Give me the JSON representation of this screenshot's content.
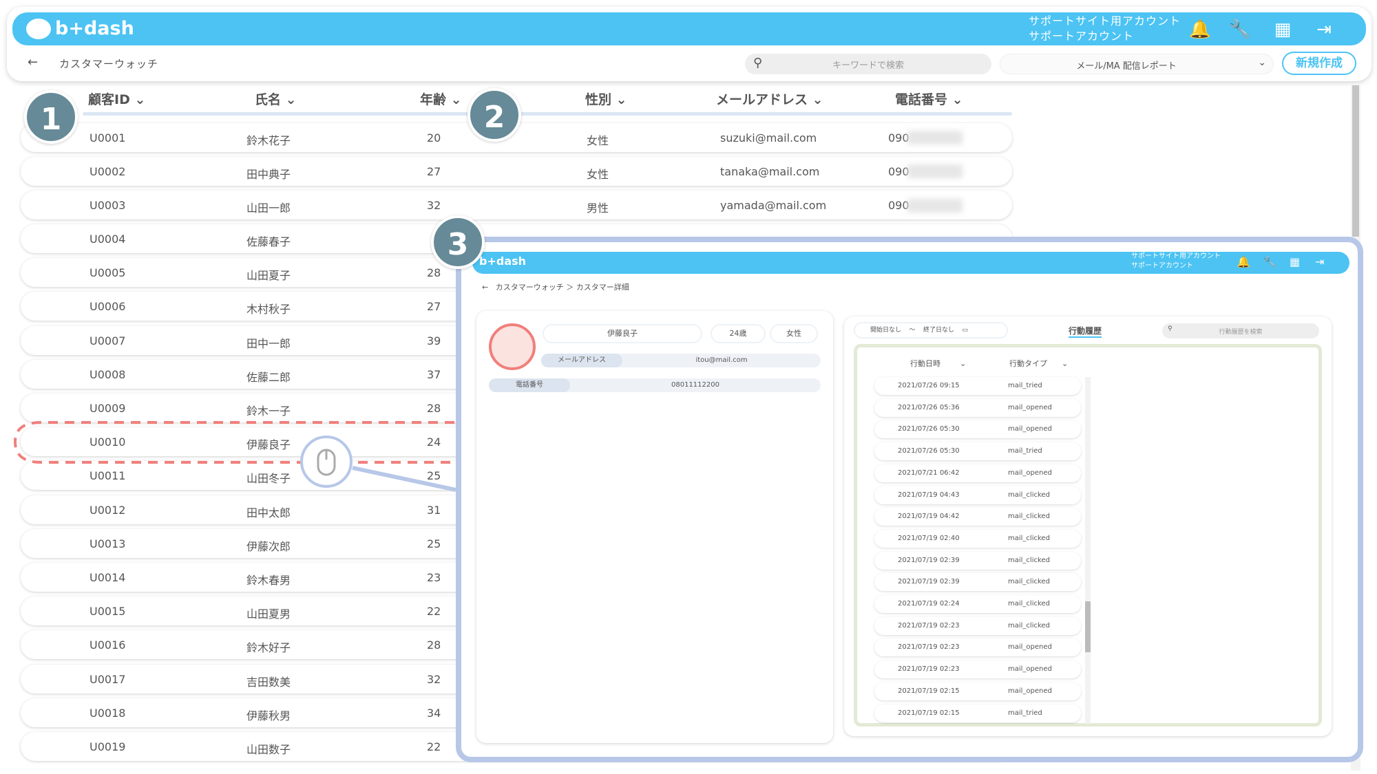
{
  "header": {
    "logo": "b+dash",
    "account_line1": "サポートサイト用アカウント",
    "account_line2": "サポートアカウント"
  },
  "nav": {
    "back": "←",
    "breadcrumb": "カスタマーウォッチ",
    "search_placeholder": "キーワードで検索",
    "report_select": "メール/MA 配信レポート",
    "new_button": "新規作成"
  },
  "columns": [
    "顧客ID",
    "氏名",
    "年齢",
    "性別",
    "メールアドレス",
    "電話番号"
  ],
  "rows": [
    {
      "id": "U0001",
      "name": "鈴木花子",
      "age": "20",
      "gender": "女性",
      "email": "suzuki@mail.com",
      "phone": "090"
    },
    {
      "id": "U0002",
      "name": "田中典子",
      "age": "27",
      "gender": "女性",
      "email": "tanaka@mail.com",
      "phone": "090"
    },
    {
      "id": "U0003",
      "name": "山田一郎",
      "age": "32",
      "gender": "男性",
      "email": "yamada@mail.com",
      "phone": "090"
    },
    {
      "id": "U0004",
      "name": "佐藤春子",
      "age": "",
      "gender": "",
      "email": "",
      "phone": ""
    },
    {
      "id": "U0005",
      "name": "山田夏子",
      "age": "28"
    },
    {
      "id": "U0006",
      "name": "木村秋子",
      "age": "27"
    },
    {
      "id": "U0007",
      "name": "田中一郎",
      "age": "39"
    },
    {
      "id": "U0008",
      "name": "佐藤二郎",
      "age": "37"
    },
    {
      "id": "U0009",
      "name": "鈴木一子",
      "age": "28"
    },
    {
      "id": "U0010",
      "name": "伊藤良子",
      "age": "24"
    },
    {
      "id": "U0011",
      "name": "山田冬子",
      "age": "25"
    },
    {
      "id": "U0012",
      "name": "田中太郎",
      "age": "31"
    },
    {
      "id": "U0013",
      "name": "伊藤次郎",
      "age": "25"
    },
    {
      "id": "U0014",
      "name": "鈴木春男",
      "age": "23"
    },
    {
      "id": "U0015",
      "name": "山田夏男",
      "age": "22"
    },
    {
      "id": "U0016",
      "name": "鈴木好子",
      "age": "28"
    },
    {
      "id": "U0017",
      "name": "吉田数美",
      "age": "32"
    },
    {
      "id": "U0018",
      "name": "伊藤秋男",
      "age": "34"
    },
    {
      "id": "U0019",
      "name": "山田数子",
      "age": "22"
    }
  ],
  "badges": [
    "1",
    "2",
    "3"
  ],
  "detail": {
    "logo": "b+dash",
    "account_line1": "サポートサイト用アカウント",
    "account_line2": "サポートアカウント",
    "breadcrumb": "カスタマーウォッチ ＞ カスタマー詳細",
    "name": "伊藤良子",
    "age": "24歳",
    "gender": "女性",
    "email_label": "メールアドレス",
    "email": "itou@mail.com",
    "phone_label": "電話番号",
    "phone": "08011112200",
    "start_date": "開始日なし",
    "tilde": "～",
    "end_date": "終了日なし",
    "history_title": "行動履歴",
    "history_search": "行動履歴を検索",
    "col_date": "行動日時",
    "col_type": "行動タイプ",
    "history": [
      {
        "date": "2021/07/26 09:15",
        "type": "mail_tried"
      },
      {
        "date": "2021/07/26 05:36",
        "type": "mail_opened"
      },
      {
        "date": "2021/07/26 05:30",
        "type": "mail_opened"
      },
      {
        "date": "2021/07/26 05:30",
        "type": "mail_tried"
      },
      {
        "date": "2021/07/21 06:42",
        "type": "mail_opened"
      },
      {
        "date": "2021/07/19 04:43",
        "type": "mail_clicked"
      },
      {
        "date": "2021/07/19 04:42",
        "type": "mail_clicked"
      },
      {
        "date": "2021/07/19 02:40",
        "type": "mail_clicked"
      },
      {
        "date": "2021/07/19 02:39",
        "type": "mail_clicked"
      },
      {
        "date": "2021/07/19 02:39",
        "type": "mail_clicked"
      },
      {
        "date": "2021/07/19 02:24",
        "type": "mail_clicked"
      },
      {
        "date": "2021/07/19 02:23",
        "type": "mail_clicked"
      },
      {
        "date": "2021/07/19 02:23",
        "type": "mail_opened"
      },
      {
        "date": "2021/07/19 02:23",
        "type": "mail_opened"
      },
      {
        "date": "2021/07/19 02:15",
        "type": "mail_opened"
      },
      {
        "date": "2021/07/19 02:15",
        "type": "mail_tried"
      }
    ]
  },
  "icons": {
    "bell": "bell-icon",
    "wrench": "wrench-icon",
    "grid": "grid-icon",
    "logout": "logout-icon",
    "search": "search-icon",
    "mouse": "mouse-click-icon"
  },
  "colors": {
    "brand": "#4cc3f3",
    "badge": "#668a97",
    "highlight": "#f07f7b",
    "frame": "#b7c7e8"
  }
}
